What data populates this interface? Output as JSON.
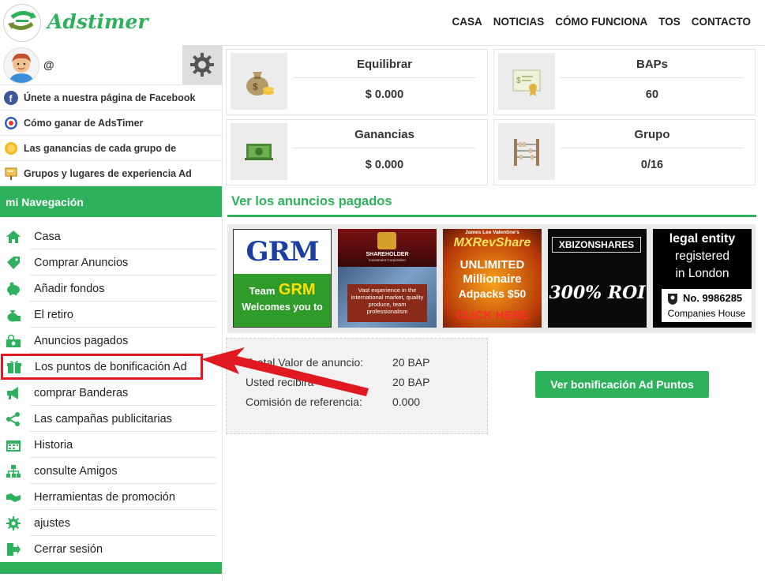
{
  "brand": {
    "name": "Adstimer"
  },
  "nav": [
    "CASA",
    "NOTICIAS",
    "CÓMO FUNCIONA",
    "TOS",
    "CONTACTO"
  ],
  "profile": {
    "username_prefix": "@"
  },
  "sidebar_links": [
    {
      "label": "Únete a nuestra página de Facebook",
      "icon": "facebook-icon"
    },
    {
      "label": "Cómo ganar de AdsTimer",
      "icon": "target-icon"
    },
    {
      "label": "Las ganancias de cada grupo de",
      "icon": "coin-icon"
    },
    {
      "label": "Grupos y lugares de experiencia Ad",
      "icon": "presentation-icon"
    }
  ],
  "nav_header": "mi Navegación",
  "menu": [
    {
      "label": "Casa",
      "icon": "home-icon"
    },
    {
      "label": "Comprar Anuncios",
      "icon": "tag-icon"
    },
    {
      "label": "Añadir fondos",
      "icon": "piggy-bank-icon"
    },
    {
      "label": "El retiro",
      "icon": "money-bag-icon"
    },
    {
      "label": "Anuncios pagados",
      "icon": "cash-icon"
    },
    {
      "label": "Los puntos de bonificación Ad",
      "icon": "gift-icon"
    },
    {
      "label": "comprar Banderas",
      "icon": "megaphone-icon"
    },
    {
      "label": "Las campañas publicitarias",
      "icon": "share-icon"
    },
    {
      "label": "Historia",
      "icon": "calendar-icon"
    },
    {
      "label": "consulte Amigos",
      "icon": "sitemap-icon"
    },
    {
      "label": "Herramientas de promoción",
      "icon": "handshake-icon"
    },
    {
      "label": "ajustes",
      "icon": "gear-icon"
    },
    {
      "label": "Cerrar sesión",
      "icon": "logout-icon"
    }
  ],
  "cards": [
    {
      "title": "Equilibrar",
      "value": "$ 0.000",
      "icon": "money-bag-icon"
    },
    {
      "title": "BAPs",
      "value": "60",
      "icon": "certificate-icon"
    },
    {
      "title": "Ganancias",
      "value": "$ 0.000",
      "icon": "banknotes-icon"
    },
    {
      "title": "Grupo",
      "value": "0/16",
      "icon": "abacus-icon"
    }
  ],
  "section_title": "Ver los anuncios pagados",
  "ads": [
    {
      "line1": "GRM",
      "line2": "Team",
      "line3": "GRM",
      "line4": "Welcomes you to"
    },
    {
      "line1": "SHAREHOLDER",
      "line2": "Investment Corporation",
      "line3": "Vast experience in the international market, quality produce, team professionalism"
    },
    {
      "line1": "James Lee Valentine's",
      "line2": "MXRevShare",
      "line3": "UNLIMITED",
      "line4": "Millionaire",
      "line5": "Adpacks $50",
      "line6": "CLICK HERE"
    },
    {
      "line1": "XBIZONSHARES",
      "line2": "300% ROI"
    },
    {
      "line1": "legal entity",
      "line2": "registered",
      "line3": "in London",
      "line4": "No. 9986285",
      "line5": "Companies House"
    }
  ],
  "stats": [
    {
      "label": "Toatal Valor de anuncio:",
      "value": "20 BAP"
    },
    {
      "label": "Usted recibirá",
      "value": "20 BAP"
    },
    {
      "label": "Comisión de referencia:",
      "value": "0.000"
    }
  ],
  "bonus_button": "Ver bonificación Ad Puntos",
  "colors": {
    "brand_green": "#2db25b",
    "highlight_red": "#e01820"
  }
}
